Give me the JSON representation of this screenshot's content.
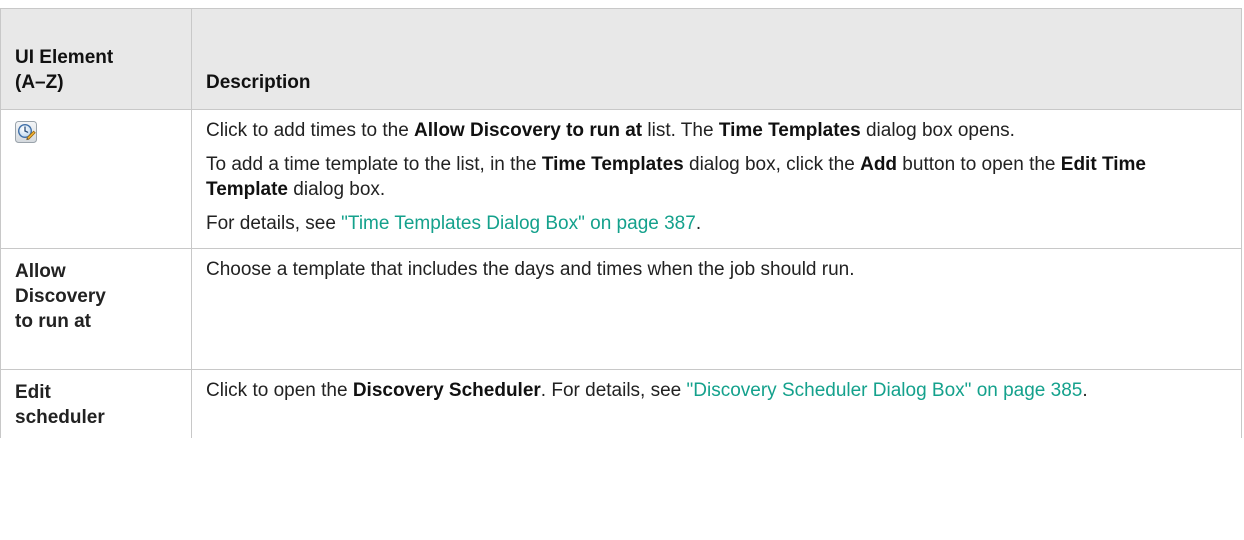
{
  "table": {
    "headers": {
      "element": [
        "UI Element",
        "(A–Z)"
      ],
      "description": "Description"
    },
    "rows": [
      {
        "icon": "clock-add-icon",
        "paragraphs": [
          [
            {
              "t": "Click to add times to the "
            },
            {
              "b": "Allow Discovery to run at"
            },
            {
              "t": " list. The "
            },
            {
              "b": "Time Templates"
            },
            {
              "t": " dialog box opens."
            }
          ],
          [
            {
              "t": "To add a time template to the list, in the "
            },
            {
              "b": "Time Templates"
            },
            {
              "t": " dialog box, click the "
            },
            {
              "b": "Add"
            },
            {
              "t": " button to open the "
            },
            {
              "b": "Edit Time Template"
            },
            {
              "t": " dialog box."
            }
          ],
          [
            {
              "t": "For details, see "
            },
            {
              "link": "\"Time Templates Dialog Box\" on page 387"
            },
            {
              "t": "."
            }
          ]
        ]
      },
      {
        "element_lines": [
          "Allow",
          "Discovery",
          "to run at"
        ],
        "paragraphs": [
          [
            {
              "t": "Choose a template that includes the days and times when the job should run."
            }
          ]
        ]
      },
      {
        "element_lines": [
          "Edit",
          "scheduler"
        ],
        "paragraphs": [
          [
            {
              "t": "Click to open the "
            },
            {
              "b": "Discovery Scheduler"
            },
            {
              "t": ". For details, see "
            },
            {
              "link": "\"Discovery Scheduler Dialog Box\" on page 385"
            },
            {
              "t": "."
            }
          ]
        ]
      }
    ]
  },
  "colors": {
    "header_bg": "#e8e8e8",
    "border": "#c8c8c8",
    "link": "#14a18c",
    "text": "#222222"
  }
}
